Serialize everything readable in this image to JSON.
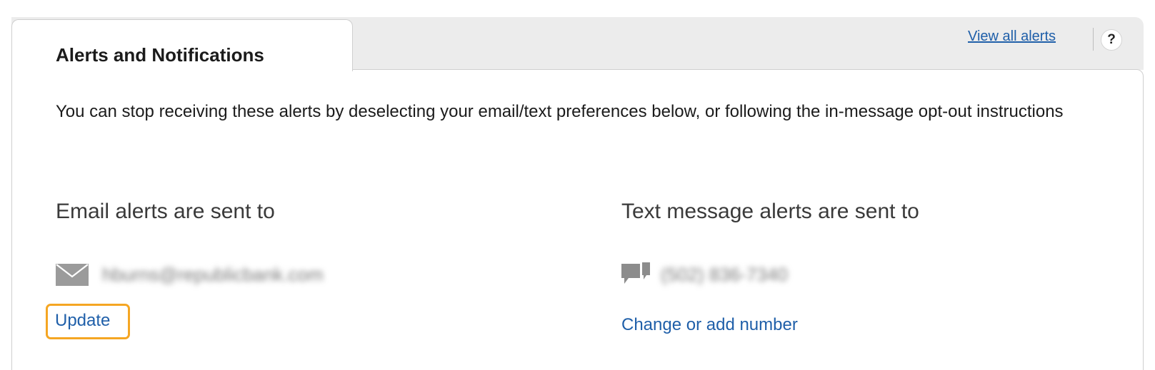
{
  "tab": {
    "label": "Alerts and Notifications"
  },
  "toolbar": {
    "view_all_label": "View all alerts",
    "help_glyph": "?",
    "help_icon": "help-icon"
  },
  "intro_text": "You can stop receiving these alerts by deselecting your email/text preferences below, or following the in-message opt-out instructions",
  "email": {
    "heading": "Email alerts are sent to",
    "icon": "envelope-icon",
    "address": "hburns@republicbank.com",
    "update_label": "Update"
  },
  "text": {
    "heading": "Text message alerts are sent to",
    "icon": "chat-icon",
    "number": "(502) 836-7340",
    "change_label": "Change or add number"
  },
  "colors": {
    "link": "#1f5fa9",
    "highlight": "#f5a623",
    "tab_strip": "#ececec",
    "icon_gray": "#9b9b9b"
  }
}
